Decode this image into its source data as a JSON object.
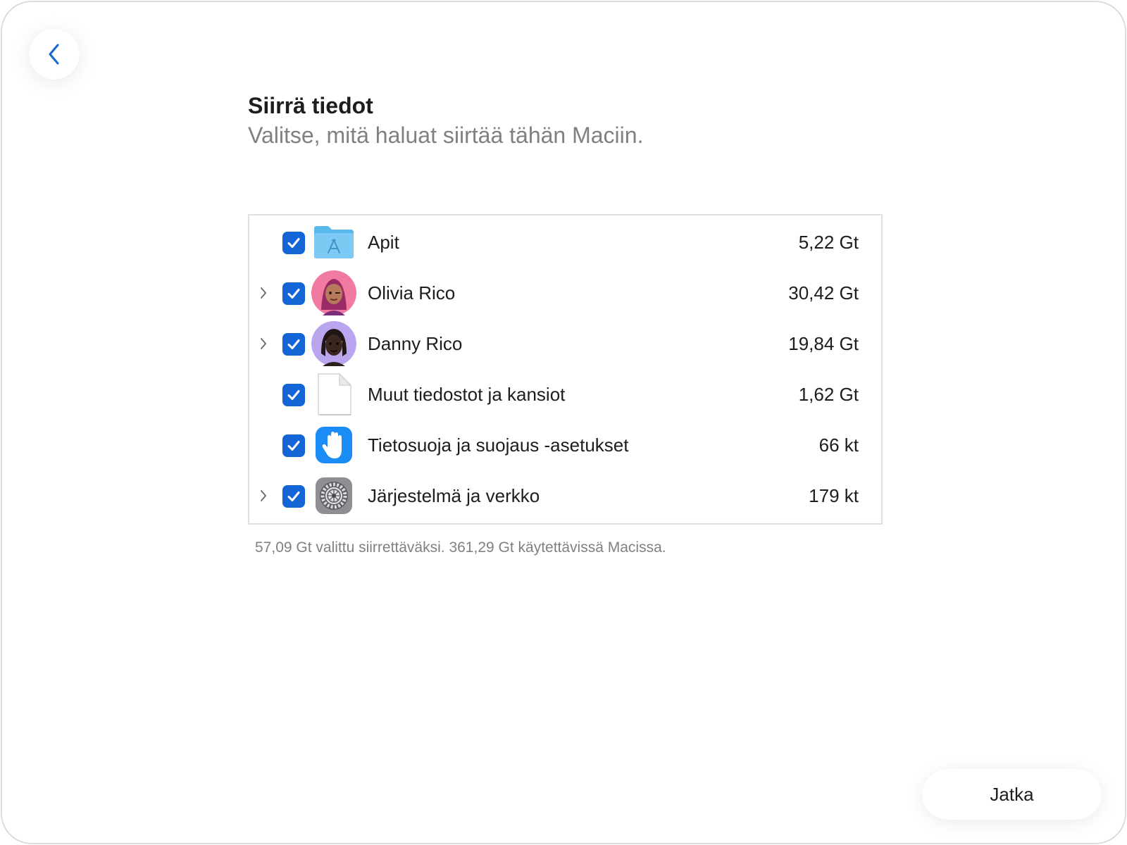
{
  "header": {
    "title": "Siirrä tiedot",
    "subtitle": "Valitse, mitä haluat siirtää tähän Maciin."
  },
  "items": [
    {
      "label": "Apit",
      "size": "5,22 Gt",
      "checked": true,
      "expandable": false,
      "icon": "applications-folder-icon"
    },
    {
      "label": "Olivia Rico",
      "size": "30,42 Gt",
      "checked": true,
      "expandable": true,
      "icon": "user-avatar-icon"
    },
    {
      "label": "Danny Rico",
      "size": "19,84 Gt",
      "checked": true,
      "expandable": true,
      "icon": "user-avatar-icon"
    },
    {
      "label": "Muut tiedostot ja kansiot",
      "size": "1,62 Gt",
      "checked": true,
      "expandable": false,
      "icon": "document-icon"
    },
    {
      "label": "Tietosuoja ja suojaus -asetukset",
      "size": "66 kt",
      "checked": true,
      "expandable": false,
      "icon": "privacy-hand-icon"
    },
    {
      "label": "Järjestelmä ja verkko",
      "size": "179 kt",
      "checked": true,
      "expandable": true,
      "icon": "system-settings-gear-icon"
    }
  ],
  "summary": "57,09 Gt valittu siirrettäväksi. 361,29 Gt käytettävissä Macissa.",
  "actions": {
    "continue_label": "Jatka"
  },
  "colors": {
    "accent": "#1466d6",
    "secondary_text": "#808080"
  }
}
